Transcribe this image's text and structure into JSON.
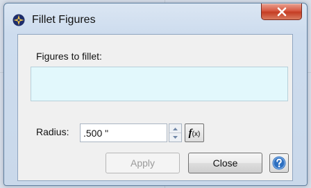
{
  "window": {
    "title": "Fillet Figures",
    "app_icon": "compass-star-icon",
    "close_icon": "close-icon"
  },
  "figures": {
    "label": "Figures to fillet:",
    "value": ""
  },
  "radius": {
    "label": "Radius:",
    "value": ".500 \""
  },
  "fx": {
    "label_f": "f",
    "label_x": "(x)"
  },
  "buttons": {
    "apply_label": "Apply",
    "close_label": "Close",
    "help_icon": "help-icon"
  },
  "colors": {
    "close_accent": "#c53d24",
    "list_background": "#e2f8fc",
    "help_blue": "#2d6fc0"
  }
}
